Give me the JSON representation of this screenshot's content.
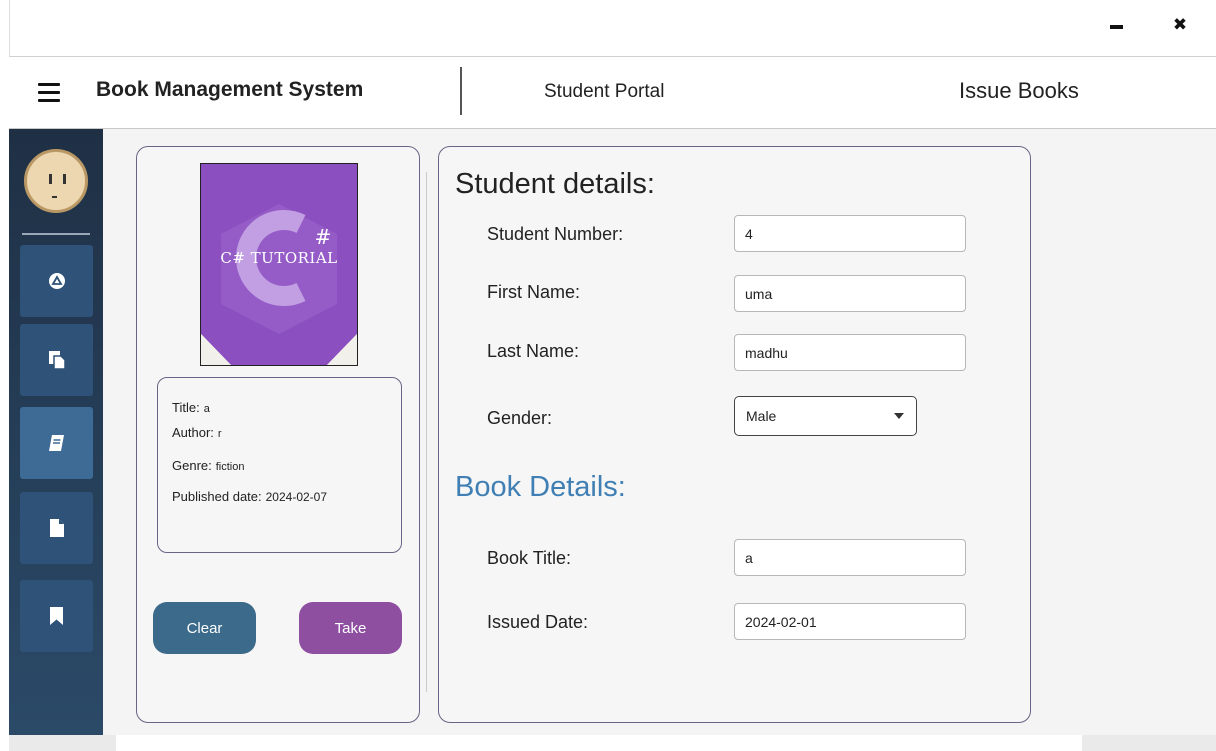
{
  "window": {
    "minimize_icon": "minimize-icon",
    "close_glyph": "✖",
    "close_icon": "close-icon"
  },
  "header": {
    "menu_icon": "hamburger-menu-icon",
    "app_title": "Book Management System",
    "portal_label": "Student Portal",
    "page_heading": "Issue Books"
  },
  "sidebar": {
    "avatar": "avatar-face",
    "items": [
      {
        "icon": "dashboard-icon",
        "active": false
      },
      {
        "icon": "copy-icon",
        "active": false
      },
      {
        "icon": "book-icon",
        "active": true
      },
      {
        "icon": "file-icon",
        "active": false
      },
      {
        "icon": "bookmark-icon",
        "active": false
      }
    ]
  },
  "book_preview": {
    "cover_text": "C# TUTORIAL",
    "title_label": "Title:",
    "title_value": "a",
    "author_label": "Author:",
    "author_value": "r",
    "genre_label": "Genre:",
    "genre_value": "fiction",
    "published_label": "Published date:",
    "published_value": "2024-02-07"
  },
  "actions": {
    "clear_label": "Clear",
    "take_label": "Take"
  },
  "student_details": {
    "heading": "Student details:",
    "student_number_label": "Student Number:",
    "student_number_value": "4",
    "first_name_label": "First Name:",
    "first_name_value": "uma",
    "last_name_label": "Last Name:",
    "last_name_value": "madhu",
    "gender_label": "Gender:",
    "gender_value": "Male"
  },
  "book_details": {
    "heading": "Book Details:",
    "book_title_label": "Book Title:",
    "book_title_value": "a",
    "issued_date_label": "Issued Date:",
    "issued_date_value": "2024-02-01"
  },
  "colors": {
    "sidebar": "#2b4a68",
    "clear_button": "#3b6a8a",
    "take_button": "#8e4fa0",
    "book_heading": "#3f7fb4",
    "cover_purple": "#8b4fbf"
  }
}
